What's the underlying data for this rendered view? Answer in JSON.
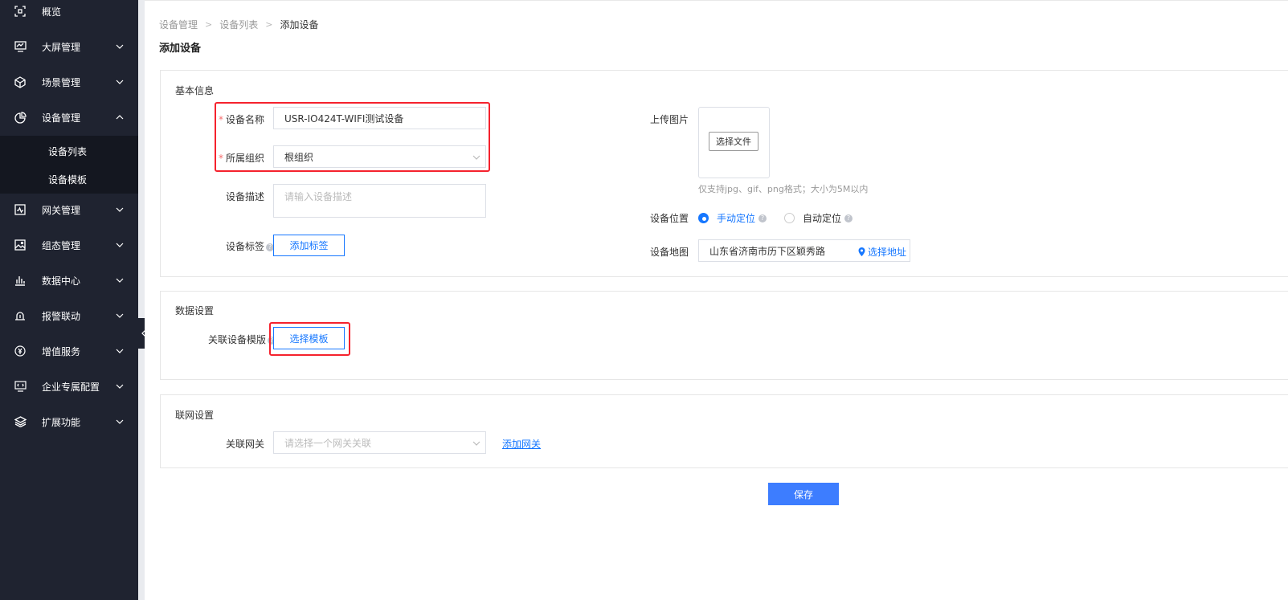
{
  "sidebar": {
    "items": [
      {
        "label": "概览",
        "icon": "overview-icon"
      },
      {
        "label": "大屏管理",
        "icon": "monitor-icon"
      },
      {
        "label": "场景管理",
        "icon": "cube-icon"
      },
      {
        "label": "设备管理",
        "icon": "pie-chart-icon"
      },
      {
        "label": "网关管理",
        "icon": "gateway-icon"
      },
      {
        "label": "组态管理",
        "icon": "image-icon"
      },
      {
        "label": "数据中心",
        "icon": "bar-chart-icon"
      },
      {
        "label": "报警联动",
        "icon": "alarm-icon"
      },
      {
        "label": "增值服务",
        "icon": "yen-icon"
      },
      {
        "label": "企业专属配置",
        "icon": "code-monitor-icon"
      },
      {
        "label": "扩展功能",
        "icon": "layers-icon"
      }
    ],
    "sub_items": [
      "设备列表",
      "设备模板"
    ]
  },
  "breadcrumb": [
    "设备管理",
    "设备列表",
    "添加设备"
  ],
  "page_title": "添加设备",
  "basic_info": {
    "title": "基本信息",
    "device_name_label": "设备名称",
    "device_name_value": "USR-IO424T-WIFI测试设备",
    "org_label": "所属组织",
    "org_value": "根组织",
    "desc_label": "设备描述",
    "desc_placeholder": "请输入设备描述",
    "tag_label": "设备标签",
    "add_tag_button": "添加标签",
    "upload_label": "上传图片",
    "choose_file_button": "选择文件",
    "upload_hint": "仅支持jpg、gif、png格式；大小为5M以内",
    "location_label": "设备位置",
    "manual_location": "手动定位",
    "auto_location": "自动定位",
    "map_label": "设备地图",
    "map_address": "山东省济南市历下区颖秀路",
    "select_address": "选择地址"
  },
  "data_settings": {
    "title": "数据设置",
    "template_label": "关联设备模版",
    "select_template_button": "选择模板"
  },
  "network_settings": {
    "title": "联网设置",
    "gateway_label": "关联网关",
    "gateway_placeholder": "请选择一个网关关联",
    "add_gateway_link": "添加网关"
  },
  "save_button": "保存",
  "required_mark": "*",
  "help_mark": "?",
  "colors": {
    "sidebar_bg": "#1f2330",
    "primary": "#1677ff",
    "highlight": "#f5222d",
    "save_bg": "#3d7dff"
  }
}
